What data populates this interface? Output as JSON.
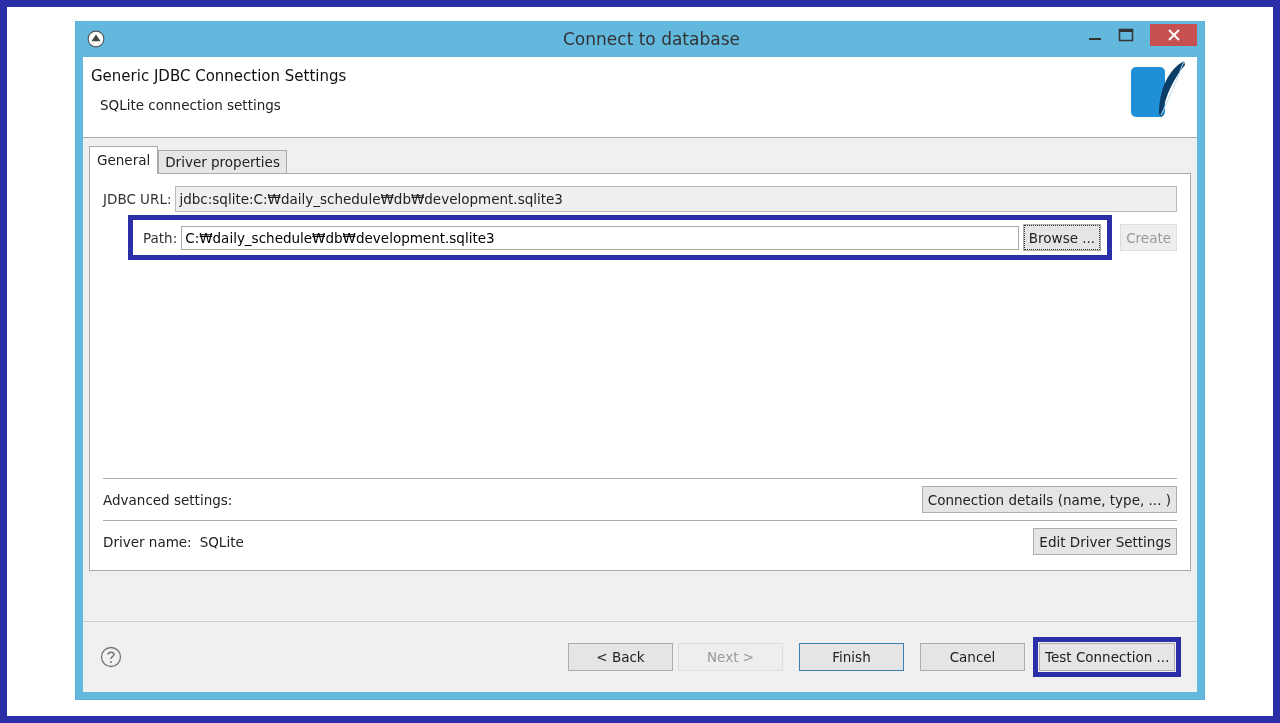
{
  "window": {
    "title": "Connect to database"
  },
  "header": {
    "title": "Generic JDBC Connection Settings",
    "subtitle": "SQLite connection settings"
  },
  "tabs": [
    {
      "label": "General",
      "selected": true
    },
    {
      "label": "Driver properties",
      "selected": false
    }
  ],
  "jdbc_url": {
    "label": "JDBC URL:",
    "value": "jdbc:sqlite:C:₩daily_schedule₩db₩development.sqlite3"
  },
  "path": {
    "label": "Path:",
    "value": "C:₩daily_schedule₩db₩development.sqlite3",
    "highlighted": true,
    "buttons": [
      {
        "label": "Browse ...",
        "disabled": false,
        "focused": true
      },
      {
        "label": "Create",
        "disabled": true,
        "focused": false
      }
    ]
  },
  "advanced": {
    "label": "Advanced settings:",
    "button": "Connection details (name, type, ... )"
  },
  "driver": {
    "label": "Driver name:",
    "value": "SQLite",
    "button": "Edit Driver Settings"
  },
  "footer_buttons": [
    {
      "label": "< Back",
      "disabled": false,
      "default": false,
      "highlighted": false
    },
    {
      "label": "Next >",
      "disabled": true,
      "default": false,
      "highlighted": false
    },
    {
      "label": "Finish",
      "disabled": false,
      "default": true,
      "highlighted": false
    },
    {
      "label": "Cancel",
      "disabled": false,
      "default": false,
      "highlighted": false
    },
    {
      "label": "Test Connection ...",
      "disabled": false,
      "default": false,
      "highlighted": true
    }
  ]
}
